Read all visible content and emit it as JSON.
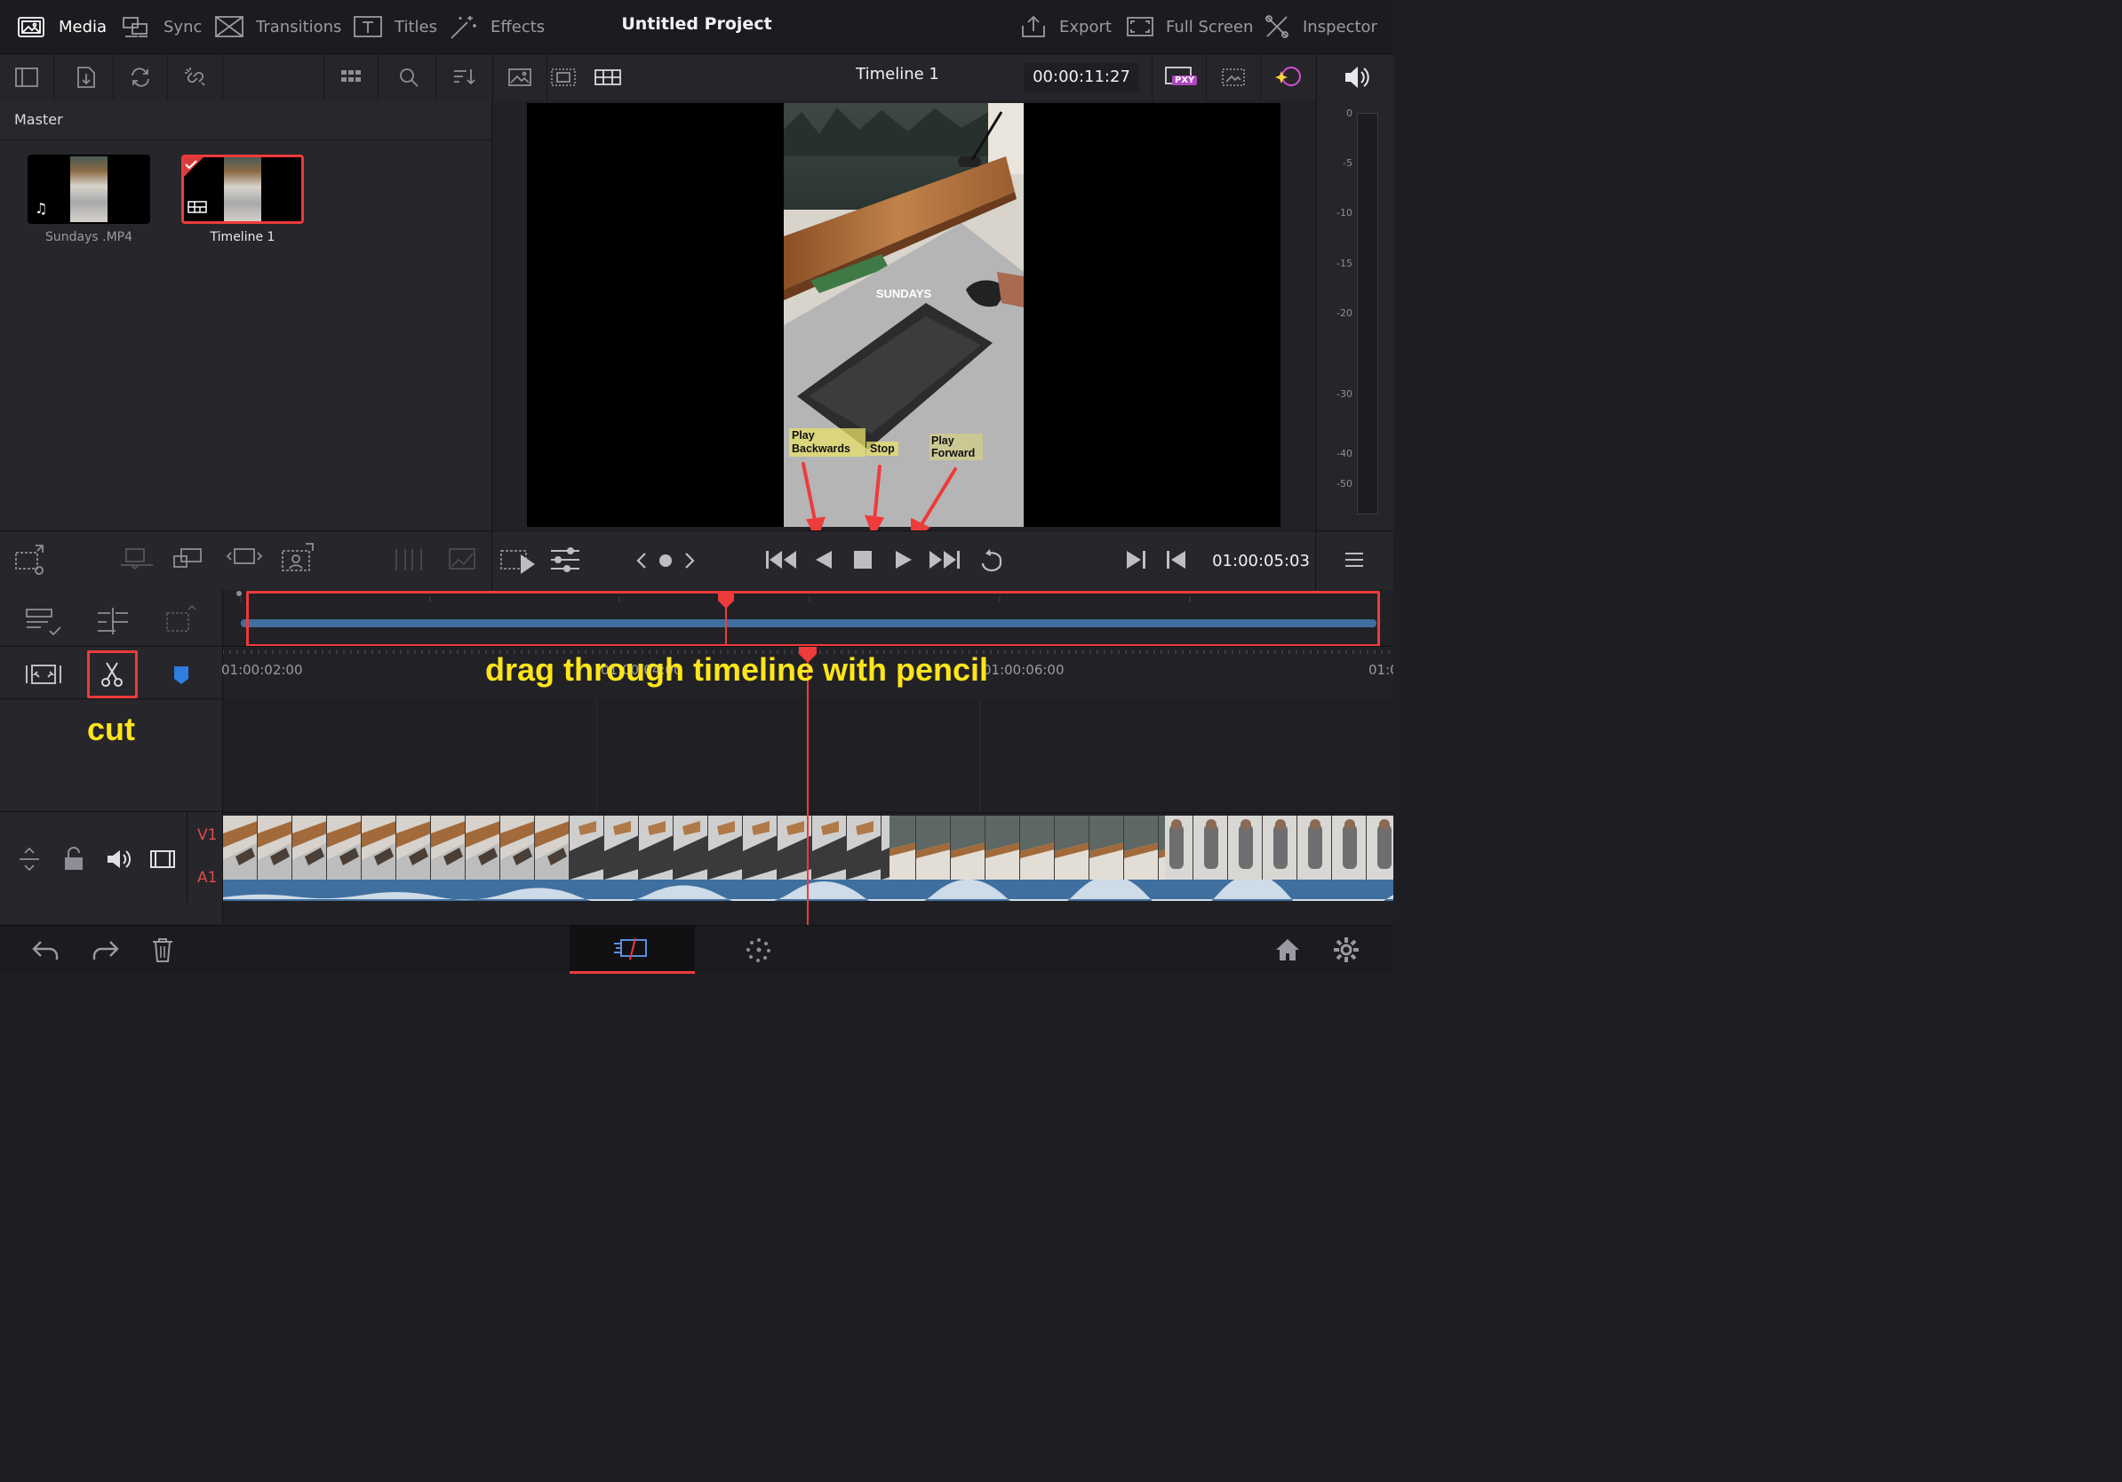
{
  "topbar": {
    "tabs": [
      {
        "label": "Media",
        "icon": "media-pool-icon",
        "active": true
      },
      {
        "label": "Sync",
        "icon": "sync-icon"
      },
      {
        "label": "Transitions",
        "icon": "transitions-icon"
      },
      {
        "label": "Titles",
        "icon": "titles-icon"
      },
      {
        "label": "Effects",
        "icon": "effects-wand-icon"
      }
    ],
    "project_title": "Untitled Project",
    "right": [
      {
        "label": "Export",
        "icon": "export-icon"
      },
      {
        "label": "Full Screen",
        "icon": "fullscreen-icon"
      },
      {
        "label": "Inspector",
        "icon": "inspector-icon"
      }
    ]
  },
  "viewer": {
    "timeline_name": "Timeline 1",
    "duration_timecode": "00:00:11:27",
    "proxy_badge": "PXY",
    "video_overlay_text": "SUNDAYS",
    "current_timecode": "01:00:05:03"
  },
  "media_pool": {
    "bin": "Master",
    "clips": [
      {
        "name": "Sundays .MP4",
        "type": "audio-video"
      },
      {
        "name": "Timeline 1",
        "type": "timeline",
        "selected": true
      }
    ]
  },
  "meter": {
    "db_scale": [
      "0",
      "-5",
      "-10",
      "-15",
      "-20",
      "-30",
      "-40",
      "-50"
    ]
  },
  "timeline": {
    "ruler": [
      "01:00:02:00",
      "01:00:04:00",
      "01:00:06:00",
      "01:0"
    ],
    "tracks": [
      "V1",
      "A1"
    ]
  },
  "annotations": {
    "play_backwards": "Play Backwards",
    "stop": "Stop",
    "play_forward": "Play Forward",
    "drag_hint": "drag through timeline with pencil",
    "cut_hint": "cut"
  },
  "colors": {
    "accent_red": "#ee3b3b",
    "annotation_yellow": "#ffe51a",
    "audio_blue": "#3f6f9e",
    "highlight_yellow": "#e8e06a"
  }
}
